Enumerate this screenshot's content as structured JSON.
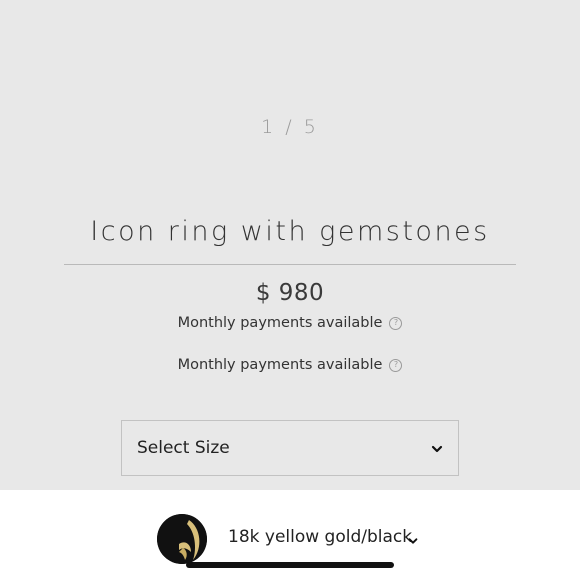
{
  "product": {
    "pager": "1 / 5",
    "title": "Icon ring with gemstones",
    "price": "$ 980",
    "monthly_payments": [
      "Monthly payments available",
      "Monthly payments available"
    ],
    "help_icon_glyph": "?"
  },
  "size_select": {
    "selected": "Select Size"
  },
  "variant": {
    "label": "18k yellow gold/black",
    "swatch_colors": [
      "#111111",
      "#d8bf7a"
    ]
  },
  "colors": {
    "background": "#e8e8e8",
    "bottom_bar": "#ffffff",
    "text": "#333333"
  }
}
